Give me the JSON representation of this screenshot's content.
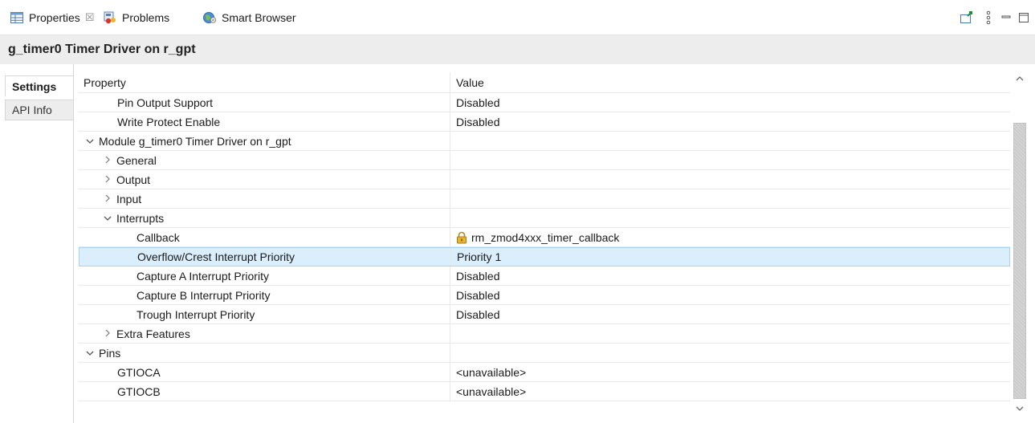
{
  "tabs": {
    "properties": "Properties",
    "problems": "Problems",
    "smart_browser": "Smart Browser",
    "close_symbol": "☒"
  },
  "toolbar_icons": [
    "pin-icon",
    "view-menu-icon",
    "minimize-icon",
    "maximize-icon"
  ],
  "title": "g_timer0 Timer Driver on r_gpt",
  "vtabs": {
    "settings": "Settings",
    "api_info": "API Info"
  },
  "table": {
    "header": {
      "property": "Property",
      "value": "Value"
    },
    "rows": [
      {
        "label": "Pin Output Support",
        "value": "Disabled"
      },
      {
        "label": "Write Protect Enable",
        "value": "Disabled"
      },
      {
        "label": "Module g_timer0 Timer Driver on r_gpt",
        "value": ""
      },
      {
        "label": "General",
        "value": ""
      },
      {
        "label": "Output",
        "value": ""
      },
      {
        "label": "Input",
        "value": ""
      },
      {
        "label": "Interrupts",
        "value": ""
      },
      {
        "label": "Callback",
        "value": "rm_zmod4xxx_timer_callback"
      },
      {
        "label": "Overflow/Crest Interrupt Priority",
        "value": "Priority 1"
      },
      {
        "label": "Capture A Interrupt Priority",
        "value": "Disabled"
      },
      {
        "label": "Capture B Interrupt Priority",
        "value": "Disabled"
      },
      {
        "label": "Trough Interrupt Priority",
        "value": "Disabled"
      },
      {
        "label": "Extra Features",
        "value": ""
      },
      {
        "label": "Pins",
        "value": ""
      },
      {
        "label": "GTIOCA",
        "value": "<unavailable>"
      },
      {
        "label": "GTIOCB",
        "value": "<unavailable>"
      }
    ]
  },
  "colors": {
    "selected_row": "#dbeefb",
    "title_bar": "#ededed",
    "accent": "#2a7fd4"
  }
}
